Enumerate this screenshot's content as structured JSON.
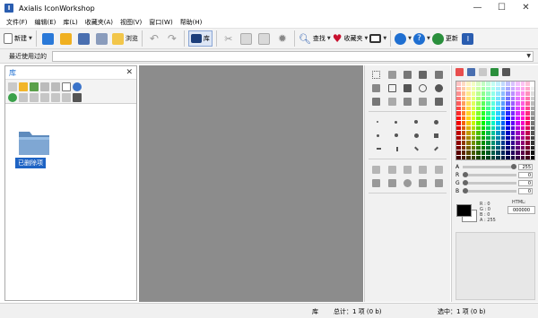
{
  "window": {
    "title": "Axialis IconWorkshop",
    "app_icon_letter": "I",
    "minimize": "—",
    "maximize": "☐",
    "close": "✕"
  },
  "menu": [
    "文件(F)",
    "编辑(E)",
    "库(L)",
    "收藏夹(A)",
    "视图(V)",
    "窗口(W)",
    "帮助(H)"
  ],
  "toolbar": {
    "new_label": "新建",
    "browse_label": "浏览",
    "library_label": "库",
    "find_label": "查找",
    "favorites_label": "收藏夹",
    "update_label": "更新"
  },
  "recent": {
    "label": "最近使用过的",
    "value": ""
  },
  "library": {
    "title": "库",
    "close": "✕",
    "folder_label": "已删除项"
  },
  "colors": {
    "html_label": "HTML:",
    "html_value": "000000",
    "sliders": [
      {
        "label": "A",
        "value": "255",
        "level": 1.0
      },
      {
        "label": "R",
        "value": "0",
        "level": 0
      },
      {
        "label": "G",
        "value": "0",
        "level": 0
      },
      {
        "label": "B",
        "value": "0",
        "level": 0
      }
    ],
    "rgba_readout": [
      "R : 0",
      "G : 0",
      "B : 0",
      "A : 255"
    ]
  },
  "status": {
    "section": "库",
    "total": "总计：1 项 (0 b)",
    "selected": "选中：1 项 (0 b)"
  }
}
